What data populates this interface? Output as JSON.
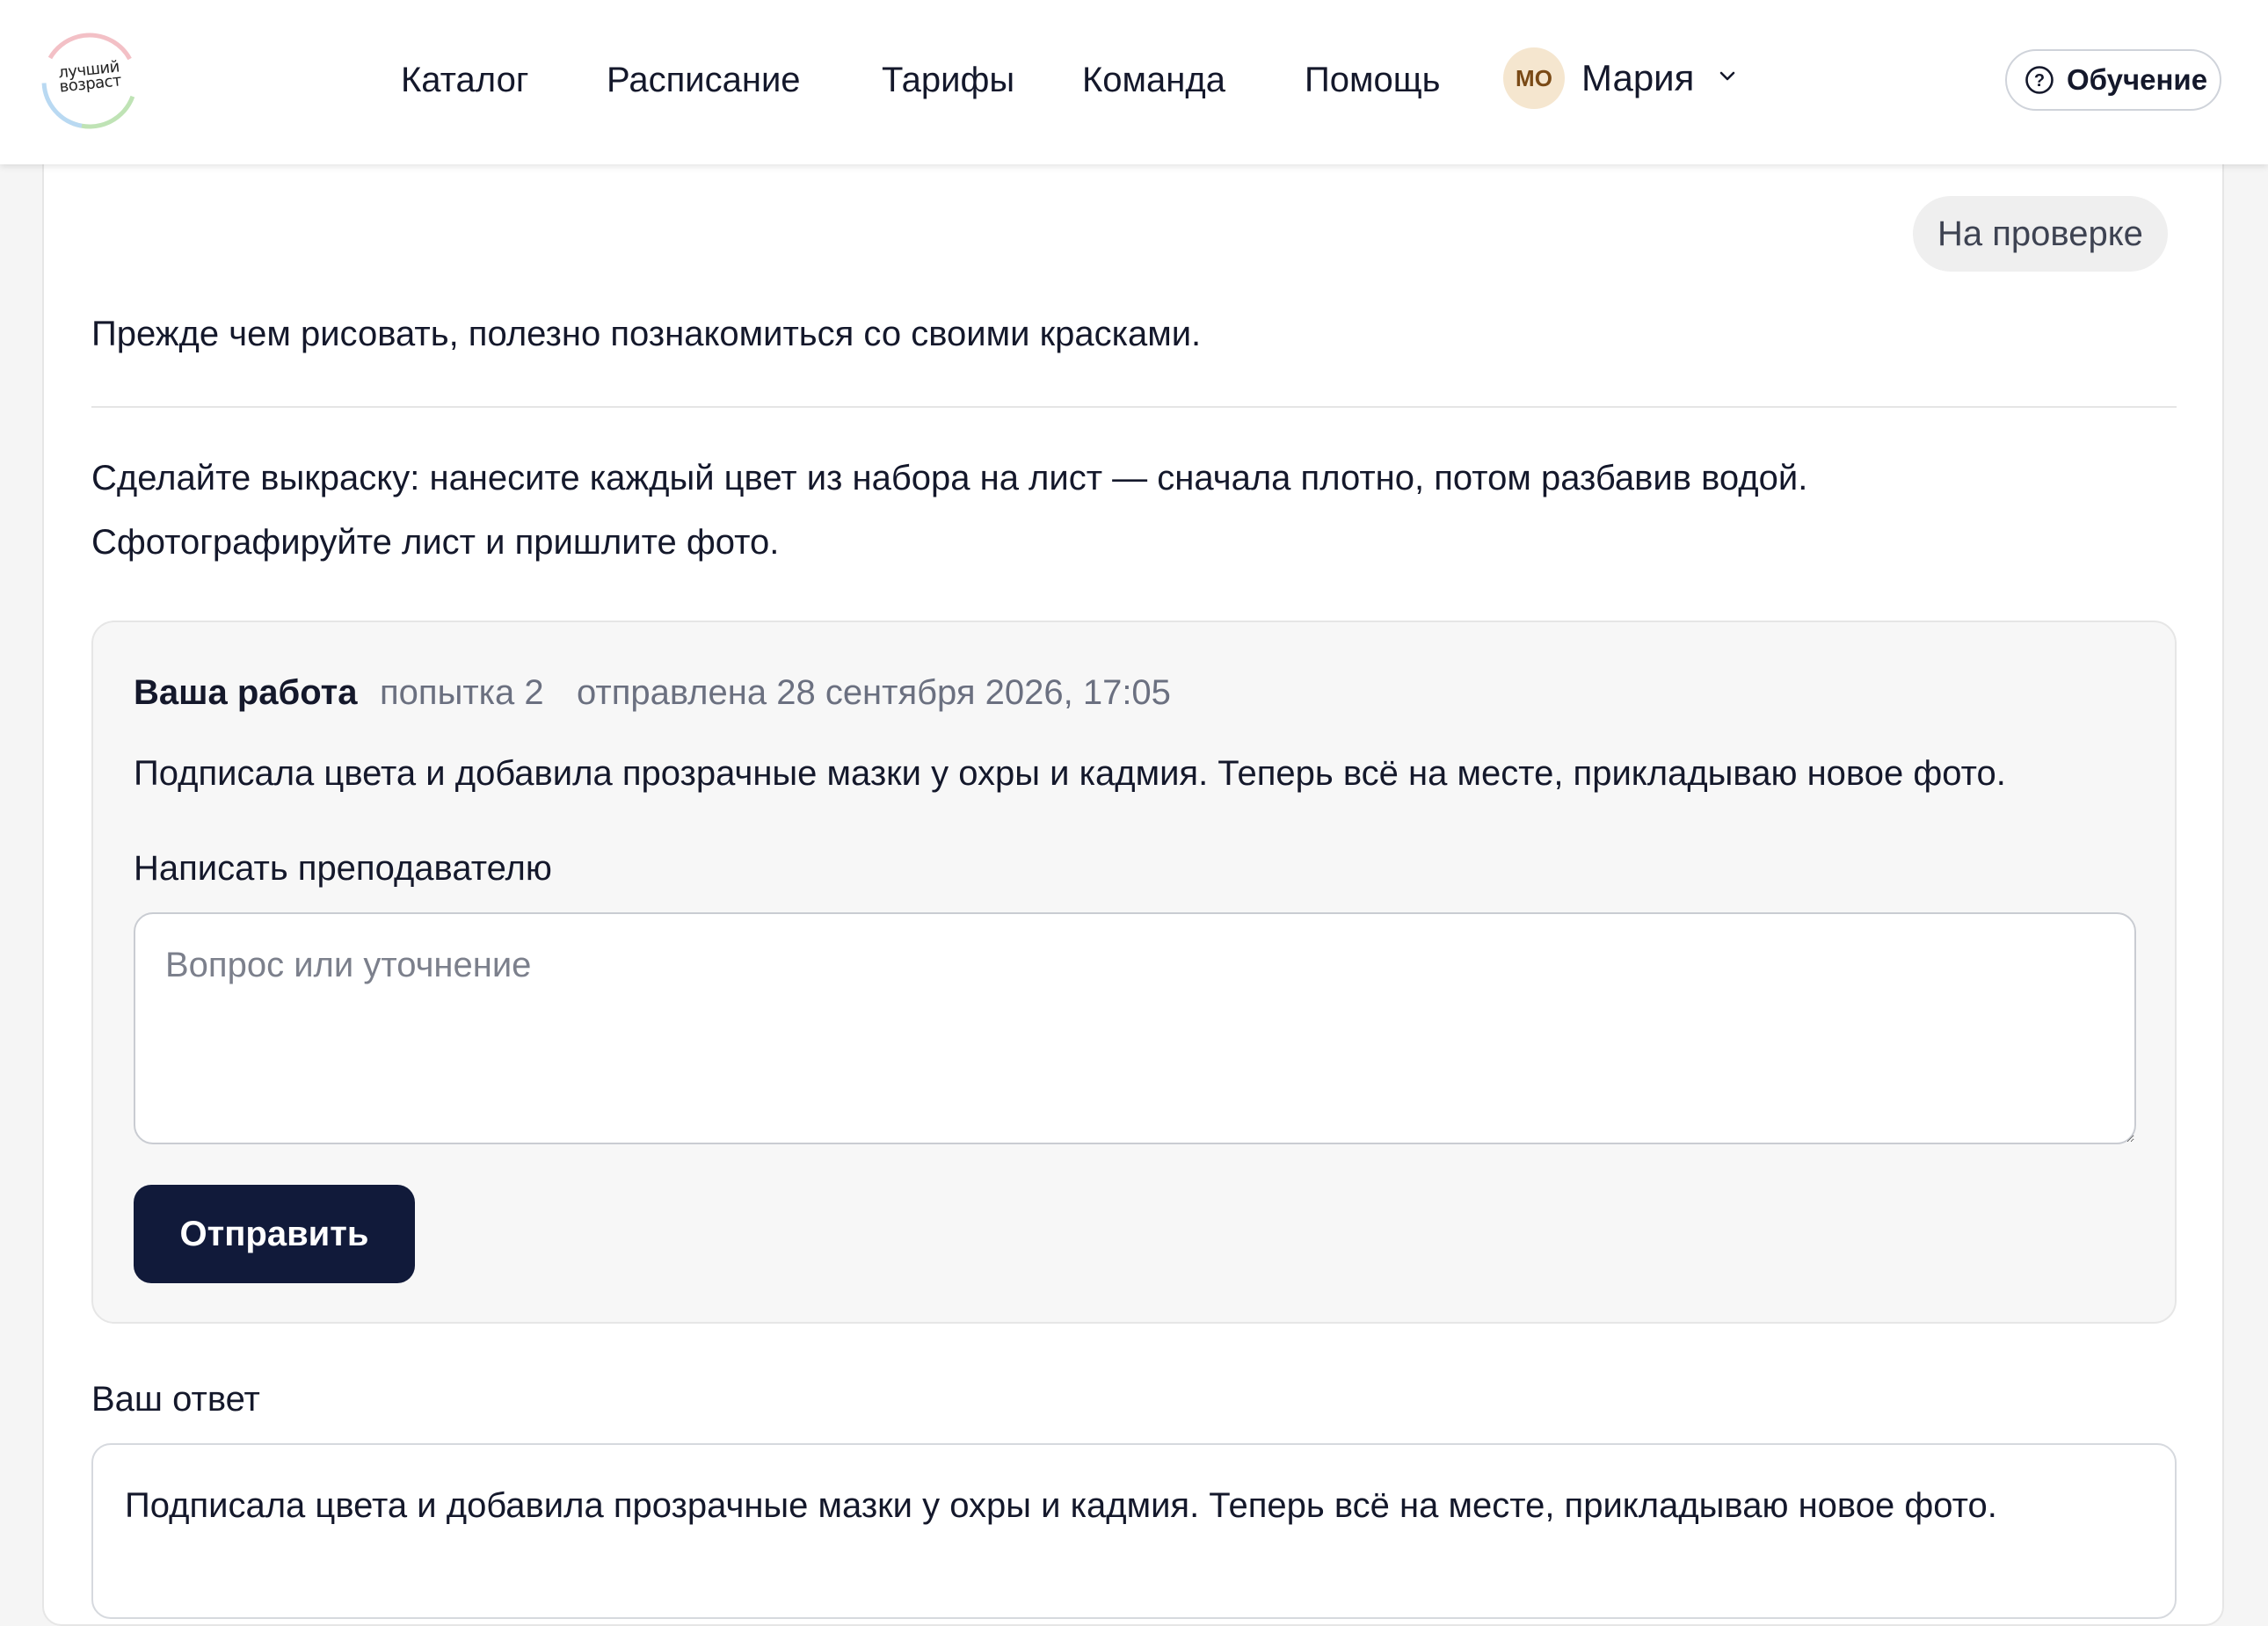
{
  "header": {
    "logo_line1": "лучший",
    "logo_line2": "возраст",
    "nav": [
      "Каталог",
      "Расписание",
      "Тарифы",
      "Команда",
      "Помощь"
    ],
    "user": {
      "initials": "МО",
      "name": "Мария"
    },
    "learn_button": "Обучение"
  },
  "task": {
    "status": "На проверке",
    "intro": "Прежде чем рисовать, полезно познакомиться со своими красками.",
    "description_line1": "Сделайте выкраску: нанесите каждый цвет из набора на лист — сначала плотно, потом разбавив водой.",
    "description_line2": "Сфотографируйте лист и пришлите фото."
  },
  "submission": {
    "title": "Ваша работа",
    "attempt": "попытка 2",
    "sent_at": "отправлена 28 сентября 2026, 17:05",
    "text": "Подписала цвета и добавила прозрачные мазки у охры и кадмия. Теперь всё на месте, прикладываю новое фото.",
    "message_label": "Написать преподавателю",
    "message_placeholder": "Вопрос или уточнение",
    "send_button": "Отправить"
  },
  "answer": {
    "label": "Ваш ответ",
    "text": "Подписала цвета и добавила прозрачные мазки у охры и кадмия. Теперь всё на месте, прикладываю новое фото."
  },
  "colors": {
    "primary_button": "#111a3a",
    "avatar_bg": "#f5e6cf",
    "avatar_text": "#7a4a16",
    "badge_bg": "#efefef"
  }
}
